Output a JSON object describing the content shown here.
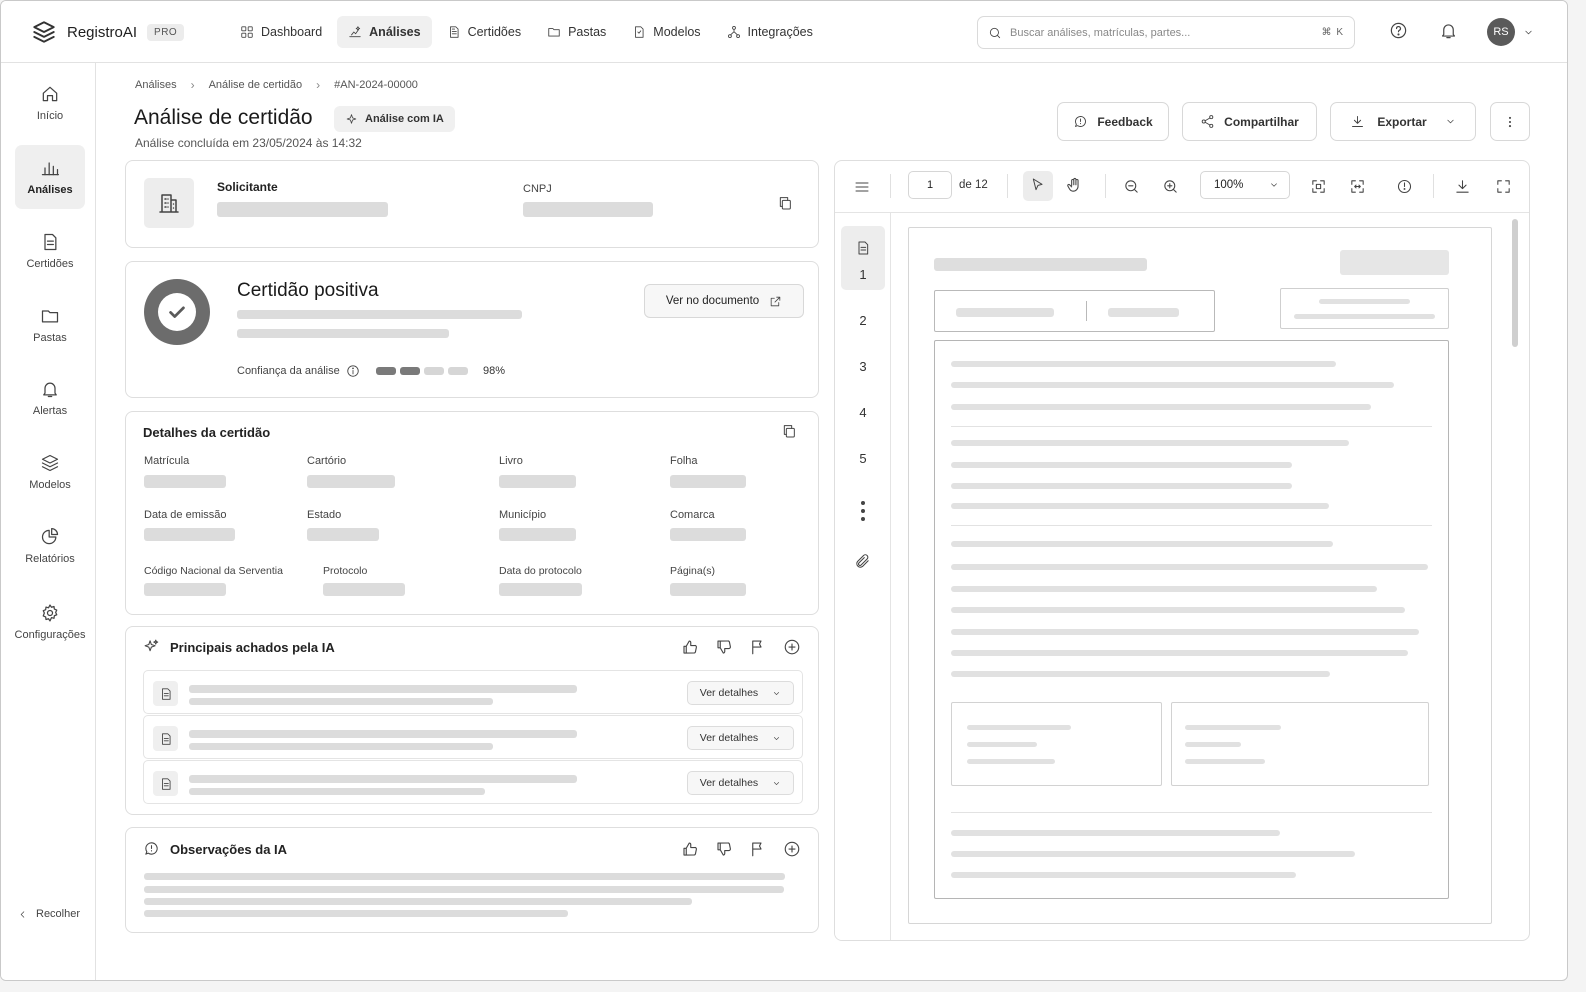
{
  "app": {
    "name": "RegistroAI",
    "badge": "PRO"
  },
  "nav": [
    {
      "label": "Dashboard",
      "icon": "grid-icon"
    },
    {
      "label": "Análises",
      "icon": "sparkle-chart-icon",
      "active": true
    },
    {
      "label": "Certidões",
      "icon": "document-icon"
    },
    {
      "label": "Pastas",
      "icon": "folder-icon"
    },
    {
      "label": "Modelos",
      "icon": "file-icon"
    },
    {
      "label": "Integrações",
      "icon": "network-icon"
    }
  ],
  "search": {
    "placeholder": "Buscar análises, matrículas, partes...",
    "shortcut": "⌘ K"
  },
  "user": {
    "initials": "RS"
  },
  "sidebar": {
    "items": [
      {
        "label": "Início",
        "icon": "home-icon"
      },
      {
        "label": "Análises",
        "icon": "bar-chart-icon",
        "active": true
      },
      {
        "label": "Certidões",
        "icon": "document-icon"
      },
      {
        "label": "Pastas",
        "icon": "folder-icon"
      },
      {
        "label": "Alertas",
        "icon": "bell-icon"
      },
      {
        "label": "Modelos",
        "icon": "layers-icon"
      },
      {
        "label": "Relatórios",
        "icon": "pie-chart-icon"
      },
      {
        "label": "Configurações",
        "icon": "gear-icon"
      }
    ],
    "collapse_label": "Recolher"
  },
  "breadcrumb": [
    "Análises",
    "Análise de certidão",
    "#AN-2024-00000"
  ],
  "page": {
    "title": "Análise de certidão",
    "ai_chip": "Análise com IA",
    "subtitle": "Análise concluída em 23/05/2024 às 14:32"
  },
  "header_actions": {
    "feedback": "Feedback",
    "share": "Compartilhar",
    "export": "Exportar"
  },
  "requester": {
    "label": "Solicitante",
    "cnpj_label": "CNPJ"
  },
  "result": {
    "title": "Certidão positiva",
    "view_doc": "Ver no documento",
    "confidence_label": "Confiança da análise",
    "confidence_value": "98%",
    "confidence_fraction": 0.98
  },
  "details": {
    "title": "Detalhes da certidão",
    "fields": [
      "Matrícula",
      "Cartório",
      "Livro",
      "Folha",
      "Data de emissão",
      "Estado",
      "Município",
      "Comarca",
      "Código Nacional da Serventia",
      "Protocolo",
      "Data do protocolo",
      "Página(s)"
    ]
  },
  "findings": {
    "title": "Principais achados pela IA",
    "detail_button": "Ver detalhes"
  },
  "observations": {
    "title": "Observações da IA"
  },
  "viewer": {
    "page": "1",
    "of_total": "de 12",
    "zoom": "100%",
    "pages": [
      "1",
      "2",
      "3",
      "4",
      "5"
    ]
  },
  "colors": {
    "accent": "#6c6c6c",
    "skeleton": "#dcdcdc",
    "border": "#dedede"
  }
}
